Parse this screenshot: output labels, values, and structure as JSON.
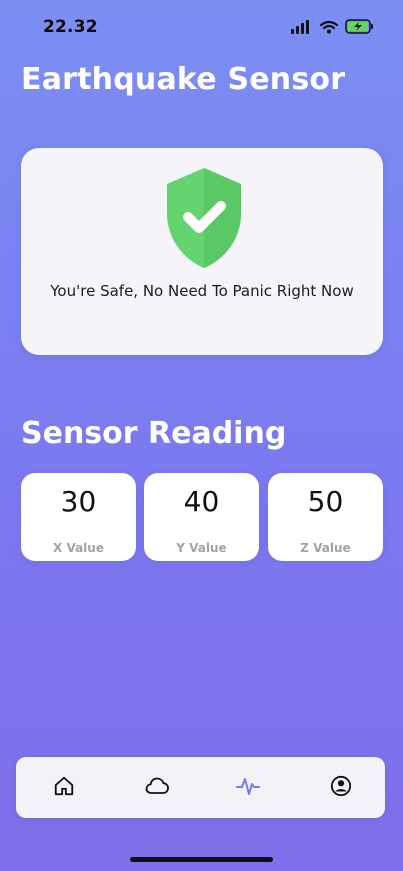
{
  "status_bar": {
    "time": "22.32",
    "icons": [
      "signal-icon",
      "wifi-icon",
      "battery-charging-icon"
    ]
  },
  "title": "Earthquake Sensor",
  "safety_card": {
    "icon": "shield-check-icon",
    "message": "You're Safe, No Need To Panic Right Now"
  },
  "sensor_section": {
    "title": "Sensor Reading",
    "readings": [
      {
        "value": "30",
        "label": "X Value"
      },
      {
        "value": "40",
        "label": "Y Value"
      },
      {
        "value": "50",
        "label": "Z Value"
      }
    ]
  },
  "bottom_nav": {
    "items": [
      {
        "icon": "home-icon",
        "active": false
      },
      {
        "icon": "cloud-icon",
        "active": false
      },
      {
        "icon": "activity-icon",
        "active": true
      },
      {
        "icon": "user-icon",
        "active": false
      }
    ]
  },
  "colors": {
    "background_top": "#7B8FF3",
    "background_bottom": "#7F6FEA",
    "card_background": "#F5F5F9",
    "shield_green": "#63D46F",
    "active_icon": "#7C78E8"
  }
}
